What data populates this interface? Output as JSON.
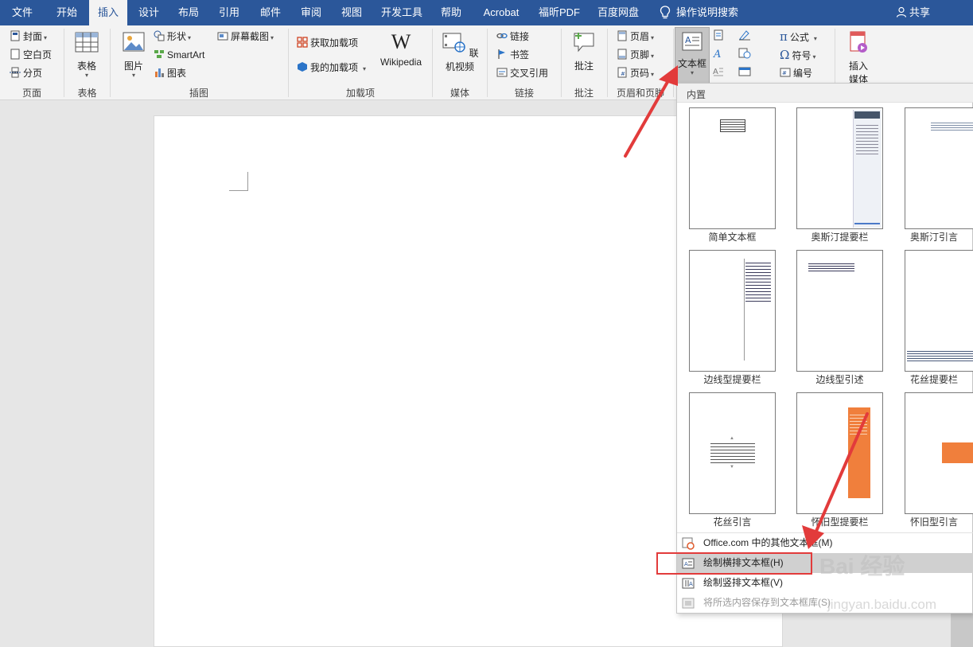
{
  "tabs": [
    {
      "label": "文件"
    },
    {
      "label": "开始"
    },
    {
      "label": "插入"
    },
    {
      "label": "设计"
    },
    {
      "label": "布局"
    },
    {
      "label": "引用"
    },
    {
      "label": "邮件"
    },
    {
      "label": "审阅"
    },
    {
      "label": "视图"
    },
    {
      "label": "开发工具"
    },
    {
      "label": "帮助"
    },
    {
      "label": "Acrobat"
    },
    {
      "label": "福昕PDF"
    },
    {
      "label": "百度网盘"
    }
  ],
  "tell_me": "操作说明搜索",
  "share": "共享",
  "ribbon": {
    "pages": {
      "cover": "封面",
      "blank": "空白页",
      "break": "分页",
      "label": "页面"
    },
    "tables": {
      "table": "表格",
      "label": "表格"
    },
    "illustrations": {
      "picture": "图片",
      "shapes": "形状",
      "smartart": "SmartArt",
      "chart": "图表",
      "screenshot": "屏幕截图",
      "label": "插图"
    },
    "addins": {
      "get": "获取加载项",
      "my": "我的加载项",
      "wikipedia": "Wikipedia",
      "label": "加载项"
    },
    "media": {
      "online_video": "联机视频",
      "label": "媒体"
    },
    "links": {
      "link": "链接",
      "bookmark": "书签",
      "crossref": "交叉引用",
      "label": "链接"
    },
    "comments": {
      "comment": "批注",
      "label": "批注"
    },
    "header_footer": {
      "header": "页眉",
      "footer": "页脚",
      "page_number": "页码",
      "label": "页眉和页脚"
    },
    "text": {
      "textbox": "文本框"
    },
    "symbols": {
      "equation": "公式",
      "symbol": "符号",
      "numbering": "编号"
    },
    "insert_media": {
      "line1": "插入",
      "line2": "媒体"
    }
  },
  "gallery": {
    "header": "内置",
    "items": [
      {
        "label": "简单文本框"
      },
      {
        "label": "奥斯汀提要栏"
      },
      {
        "label": "奥斯汀引言"
      },
      {
        "label": "边线型提要栏"
      },
      {
        "label": "边线型引述"
      },
      {
        "label": "花丝提要栏"
      },
      {
        "label": "花丝引言"
      },
      {
        "label": "怀旧型提要栏"
      },
      {
        "label": "怀旧型引言"
      }
    ],
    "menu": {
      "more": "Office.com 中的其他文本框(M)",
      "draw_horizontal": "绘制横排文本框(H)",
      "draw_vertical": "绘制竖排文本框(V)",
      "save_selection": "将所选内容保存到文本框库(S)"
    }
  },
  "watermark": {
    "brand": "Bai 经验",
    "url": "jingyan.baidu.com"
  },
  "colors": {
    "accent": "#2b579a",
    "orange": "#f07f3c",
    "annotation": "#e23b3b"
  }
}
